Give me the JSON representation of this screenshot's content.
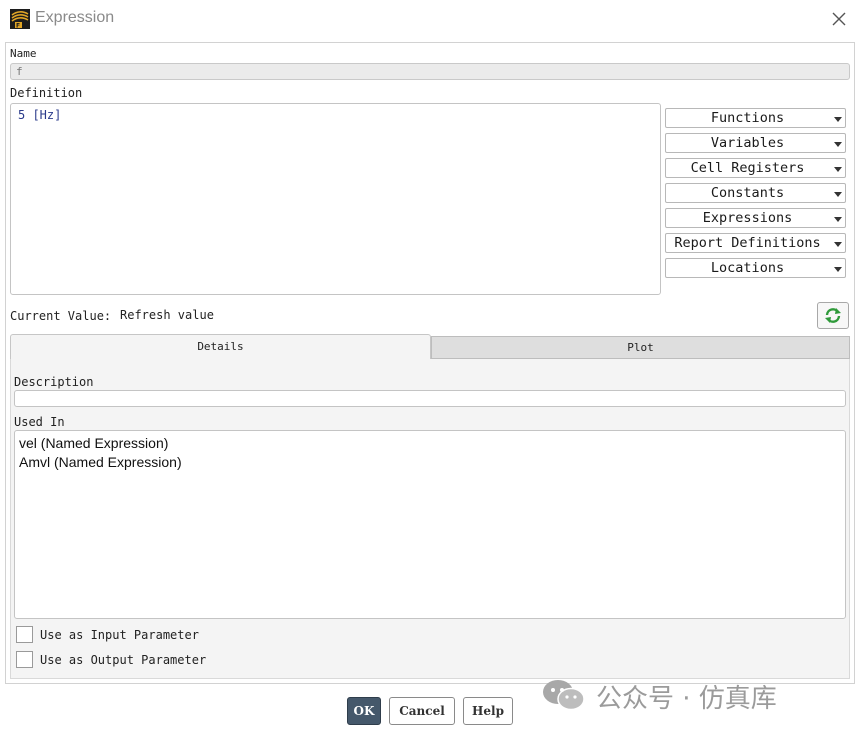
{
  "window": {
    "title": "Expression",
    "icon": "fluent-app-icon",
    "close_icon": "close-icon"
  },
  "name": {
    "label": "Name",
    "value": "f"
  },
  "definition": {
    "label": "Definition",
    "value": "5 [Hz]"
  },
  "insert_menus": [
    {
      "label": "Functions"
    },
    {
      "label": "Variables"
    },
    {
      "label": "Cell Registers"
    },
    {
      "label": "Constants"
    },
    {
      "label": "Expressions"
    },
    {
      "label": "Report Definitions"
    },
    {
      "label": "Locations"
    }
  ],
  "current_value": {
    "label": "Current Value:",
    "value": "Refresh value",
    "refresh_icon": "refresh-icon"
  },
  "tabs": [
    {
      "label": "Details",
      "active": true
    },
    {
      "label": "Plot",
      "active": false
    }
  ],
  "details": {
    "description_label": "Description",
    "description_value": "",
    "used_in_label": "Used In",
    "used_in": [
      "vel (Named Expression)",
      "Amvl (Named Expression)"
    ],
    "input_param_label": "Use as Input Parameter",
    "input_param_checked": false,
    "output_param_label": "Use as Output Parameter",
    "output_param_checked": false
  },
  "buttons": {
    "ok": "OK",
    "cancel": "Cancel",
    "help": "Help"
  },
  "watermark": {
    "text": "公众号 · 仿真库",
    "icon": "wechat-icon"
  },
  "colors": {
    "ok_button": "#45586b",
    "definition_text": "#2a3a8a",
    "refresh_green": "#2f9a3a"
  }
}
